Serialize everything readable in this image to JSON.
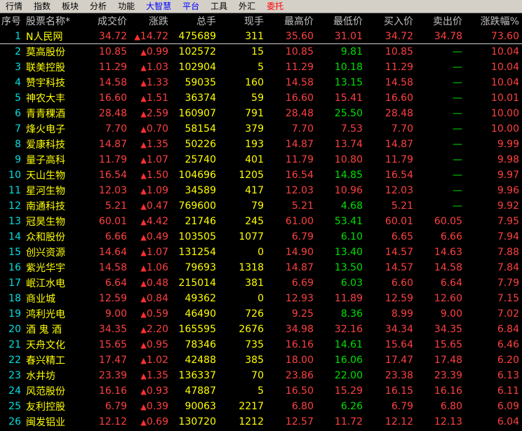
{
  "menu": [
    {
      "label": "行情",
      "color": "normal"
    },
    {
      "label": "指数",
      "color": "normal"
    },
    {
      "label": "板块",
      "color": "normal"
    },
    {
      "label": "分析",
      "color": "normal"
    },
    {
      "label": "功能",
      "color": "normal"
    },
    {
      "label": "大智慧",
      "color": "blue"
    },
    {
      "label": "平台",
      "color": "blue"
    },
    {
      "label": "工具",
      "color": "normal"
    },
    {
      "label": "外汇",
      "color": "normal"
    },
    {
      "label": "委托",
      "color": "red"
    }
  ],
  "columns": {
    "no": "序号",
    "name": "股票名称*",
    "price": "成交价",
    "chg": "涨跌",
    "vol": "总手",
    "cur": "现手",
    "high": "最高价",
    "low": "最低价",
    "bid": "买入价",
    "ask": "卖出价",
    "pct": "涨跌幅%"
  },
  "colors": {
    "up": "#ff4040",
    "down": "#00e000",
    "flat": "#e0e0e0",
    "text_yellow": "#ffff00",
    "index_cyan": "#00e0e0"
  },
  "rows": [
    {
      "no": "1",
      "name": "N人民网",
      "price": "34.72",
      "chg": "14.72",
      "vol": "475689",
      "cur": "311",
      "high": "35.60",
      "low": "31.01",
      "bid": "34.72",
      "ask": "34.78",
      "pct": "73.60",
      "high_c": "up",
      "low_c": "up",
      "bid_c": "up",
      "ask_c": "up"
    },
    {
      "no": "2",
      "name": "莫高股份",
      "price": "10.85",
      "chg": "0.99",
      "vol": "102572",
      "cur": "15",
      "high": "10.85",
      "low": "9.81",
      "bid": "10.85",
      "ask": "—",
      "pct": "10.04",
      "high_c": "up",
      "low_c": "down",
      "bid_c": "up",
      "ask_c": "down"
    },
    {
      "no": "3",
      "name": "联美控股",
      "price": "11.29",
      "chg": "1.03",
      "vol": "102904",
      "cur": "5",
      "high": "11.29",
      "low": "10.18",
      "bid": "11.29",
      "ask": "—",
      "pct": "10.04",
      "high_c": "up",
      "low_c": "down",
      "bid_c": "up",
      "ask_c": "down"
    },
    {
      "no": "4",
      "name": "赞宇科技",
      "price": "14.58",
      "chg": "1.33",
      "vol": "59035",
      "cur": "160",
      "high": "14.58",
      "low": "13.15",
      "bid": "14.58",
      "ask": "—",
      "pct": "10.04",
      "high_c": "up",
      "low_c": "down",
      "bid_c": "up",
      "ask_c": "down"
    },
    {
      "no": "5",
      "name": "神农大丰",
      "price": "16.60",
      "chg": "1.51",
      "vol": "36374",
      "cur": "59",
      "high": "16.60",
      "low": "15.41",
      "bid": "16.60",
      "ask": "—",
      "pct": "10.01",
      "high_c": "up",
      "low_c": "up",
      "bid_c": "up",
      "ask_c": "down"
    },
    {
      "no": "6",
      "name": "青青稞酒",
      "price": "28.48",
      "chg": "2.59",
      "vol": "160907",
      "cur": "791",
      "high": "28.48",
      "low": "25.50",
      "bid": "28.48",
      "ask": "—",
      "pct": "10.00",
      "high_c": "up",
      "low_c": "down",
      "bid_c": "up",
      "ask_c": "down"
    },
    {
      "no": "7",
      "name": "烽火电子",
      "price": "7.70",
      "chg": "0.70",
      "vol": "58154",
      "cur": "379",
      "high": "7.70",
      "low": "7.53",
      "bid": "7.70",
      "ask": "—",
      "pct": "10.00",
      "high_c": "up",
      "low_c": "up",
      "bid_c": "up",
      "ask_c": "down"
    },
    {
      "no": "8",
      "name": "爱康科技",
      "price": "14.87",
      "chg": "1.35",
      "vol": "50226",
      "cur": "193",
      "high": "14.87",
      "low": "13.74",
      "bid": "14.87",
      "ask": "—",
      "pct": "9.99",
      "high_c": "up",
      "low_c": "up",
      "bid_c": "up",
      "ask_c": "down"
    },
    {
      "no": "9",
      "name": "量子高科",
      "price": "11.79",
      "chg": "1.07",
      "vol": "25740",
      "cur": "401",
      "high": "11.79",
      "low": "10.80",
      "bid": "11.79",
      "ask": "—",
      "pct": "9.98",
      "high_c": "up",
      "low_c": "up",
      "bid_c": "up",
      "ask_c": "down"
    },
    {
      "no": "10",
      "name": "天山生物",
      "price": "16.54",
      "chg": "1.50",
      "vol": "104696",
      "cur": "1205",
      "high": "16.54",
      "low": "14.85",
      "bid": "16.54",
      "ask": "—",
      "pct": "9.97",
      "high_c": "up",
      "low_c": "down",
      "bid_c": "up",
      "ask_c": "down"
    },
    {
      "no": "11",
      "name": "星河生物",
      "price": "12.03",
      "chg": "1.09",
      "vol": "34589",
      "cur": "417",
      "high": "12.03",
      "low": "10.96",
      "bid": "12.03",
      "ask": "—",
      "pct": "9.96",
      "high_c": "up",
      "low_c": "up",
      "bid_c": "up",
      "ask_c": "down"
    },
    {
      "no": "12",
      "name": "南通科技",
      "price": "5.21",
      "chg": "0.47",
      "vol": "769600",
      "cur": "79",
      "high": "5.21",
      "low": "4.68",
      "bid": "5.21",
      "ask": "—",
      "pct": "9.92",
      "high_c": "up",
      "low_c": "down",
      "bid_c": "up",
      "ask_c": "down"
    },
    {
      "no": "13",
      "name": "冠昊生物",
      "price": "60.01",
      "chg": "4.42",
      "vol": "21746",
      "cur": "245",
      "high": "61.00",
      "low": "53.41",
      "bid": "60.01",
      "ask": "60.05",
      "pct": "7.95",
      "high_c": "up",
      "low_c": "down",
      "bid_c": "up",
      "ask_c": "up"
    },
    {
      "no": "14",
      "name": "众和股份",
      "price": "6.66",
      "chg": "0.49",
      "vol": "103505",
      "cur": "1077",
      "high": "6.79",
      "low": "6.10",
      "bid": "6.65",
      "ask": "6.66",
      "pct": "7.94",
      "high_c": "up",
      "low_c": "down",
      "bid_c": "up",
      "ask_c": "up"
    },
    {
      "no": "15",
      "name": "创兴资源",
      "price": "14.64",
      "chg": "1.07",
      "vol": "131254",
      "cur": "0",
      "high": "14.90",
      "low": "13.40",
      "bid": "14.57",
      "ask": "14.63",
      "pct": "7.88",
      "high_c": "up",
      "low_c": "down",
      "bid_c": "up",
      "ask_c": "up"
    },
    {
      "no": "16",
      "name": "紫光华宇",
      "price": "14.58",
      "chg": "1.06",
      "vol": "79693",
      "cur": "1318",
      "high": "14.87",
      "low": "13.50",
      "bid": "14.57",
      "ask": "14.58",
      "pct": "7.84",
      "high_c": "up",
      "low_c": "down",
      "bid_c": "up",
      "ask_c": "up"
    },
    {
      "no": "17",
      "name": "岷江水电",
      "price": "6.64",
      "chg": "0.48",
      "vol": "215014",
      "cur": "381",
      "high": "6.69",
      "low": "6.03",
      "bid": "6.60",
      "ask": "6.64",
      "pct": "7.79",
      "high_c": "up",
      "low_c": "down",
      "bid_c": "up",
      "ask_c": "up"
    },
    {
      "no": "18",
      "name": "商业城",
      "price": "12.59",
      "chg": "0.84",
      "vol": "49362",
      "cur": "0",
      "high": "12.93",
      "low": "11.89",
      "bid": "12.59",
      "ask": "12.60",
      "pct": "7.15",
      "high_c": "up",
      "low_c": "up",
      "bid_c": "up",
      "ask_c": "up"
    },
    {
      "no": "19",
      "name": "鸿利光电",
      "price": "9.00",
      "chg": "0.59",
      "vol": "46490",
      "cur": "726",
      "high": "9.25",
      "low": "8.36",
      "bid": "8.99",
      "ask": "9.00",
      "pct": "7.02",
      "high_c": "up",
      "low_c": "down",
      "bid_c": "up",
      "ask_c": "up"
    },
    {
      "no": "20",
      "name": "酒 鬼 酒",
      "price": "34.35",
      "chg": "2.20",
      "vol": "165595",
      "cur": "2676",
      "high": "34.98",
      "low": "32.16",
      "bid": "34.34",
      "ask": "34.35",
      "pct": "6.84",
      "high_c": "up",
      "low_c": "up",
      "bid_c": "up",
      "ask_c": "up"
    },
    {
      "no": "21",
      "name": "天舟文化",
      "price": "15.65",
      "chg": "0.95",
      "vol": "78346",
      "cur": "735",
      "high": "16.16",
      "low": "14.61",
      "bid": "15.64",
      "ask": "15.65",
      "pct": "6.46",
      "high_c": "up",
      "low_c": "down",
      "bid_c": "up",
      "ask_c": "up"
    },
    {
      "no": "22",
      "name": "春兴精工",
      "price": "17.47",
      "chg": "1.02",
      "vol": "42488",
      "cur": "385",
      "high": "18.00",
      "low": "16.06",
      "bid": "17.47",
      "ask": "17.48",
      "pct": "6.20",
      "high_c": "up",
      "low_c": "down",
      "bid_c": "up",
      "ask_c": "up"
    },
    {
      "no": "23",
      "name": "水井坊",
      "price": "23.39",
      "chg": "1.35",
      "vol": "136337",
      "cur": "70",
      "high": "23.86",
      "low": "22.00",
      "bid": "23.38",
      "ask": "23.39",
      "pct": "6.13",
      "high_c": "up",
      "low_c": "down",
      "bid_c": "up",
      "ask_c": "up"
    },
    {
      "no": "24",
      "name": "风范股份",
      "price": "16.16",
      "chg": "0.93",
      "vol": "47887",
      "cur": "5",
      "high": "16.50",
      "low": "15.29",
      "bid": "16.15",
      "ask": "16.16",
      "pct": "6.11",
      "high_c": "up",
      "low_c": "up",
      "bid_c": "up",
      "ask_c": "up"
    },
    {
      "no": "25",
      "name": "友利控股",
      "price": "6.79",
      "chg": "0.39",
      "vol": "90063",
      "cur": "2217",
      "high": "6.80",
      "low": "6.26",
      "bid": "6.79",
      "ask": "6.80",
      "pct": "6.09",
      "high_c": "up",
      "low_c": "down",
      "bid_c": "up",
      "ask_c": "up"
    },
    {
      "no": "26",
      "name": "闽发铝业",
      "price": "12.12",
      "chg": "0.69",
      "vol": "130720",
      "cur": "1212",
      "high": "12.57",
      "low": "11.72",
      "bid": "12.12",
      "ask": "12.13",
      "pct": "6.04",
      "high_c": "up",
      "low_c": "up",
      "bid_c": "up",
      "ask_c": "up"
    }
  ]
}
